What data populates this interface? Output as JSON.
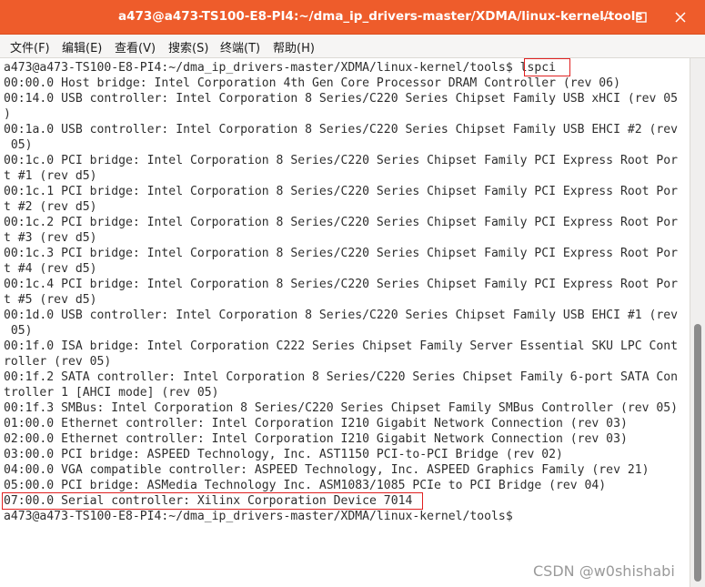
{
  "window": {
    "title": "a473@a473-TS100-E8-PI4:~/dma_ip_drivers-master/XDMA/linux-kernel/tools",
    "accent_color": "#ee5c2b",
    "controls": [
      "minimize-icon",
      "maximize-icon",
      "close-icon"
    ]
  },
  "menu": {
    "items": [
      {
        "label": "文件(F)"
      },
      {
        "label": "编辑(E)"
      },
      {
        "label": "查看(V)"
      },
      {
        "label": "搜索(S)"
      },
      {
        "label": "终端(T)"
      },
      {
        "label": "帮助(H)"
      }
    ]
  },
  "terminal": {
    "prompt": "a473@a473-TS100-E8-PI4:~/dma_ip_drivers-master/XDMA/linux-kernel/tools$",
    "command": "lspci",
    "highlight_color": "#e02020",
    "lines": [
      "00:00.0 Host bridge: Intel Corporation 4th Gen Core Processor DRAM Controller (rev 06)",
      "00:14.0 USB controller: Intel Corporation 8 Series/C220 Series Chipset Family USB xHCI (rev 05",
      ")",
      "00:1a.0 USB controller: Intel Corporation 8 Series/C220 Series Chipset Family USB EHCI #2 (rev",
      " 05)",
      "00:1c.0 PCI bridge: Intel Corporation 8 Series/C220 Series Chipset Family PCI Express Root Por",
      "t #1 (rev d5)",
      "00:1c.1 PCI bridge: Intel Corporation 8 Series/C220 Series Chipset Family PCI Express Root Por",
      "t #2 (rev d5)",
      "00:1c.2 PCI bridge: Intel Corporation 8 Series/C220 Series Chipset Family PCI Express Root Por",
      "t #3 (rev d5)",
      "00:1c.3 PCI bridge: Intel Corporation 8 Series/C220 Series Chipset Family PCI Express Root Por",
      "t #4 (rev d5)",
      "00:1c.4 PCI bridge: Intel Corporation 8 Series/C220 Series Chipset Family PCI Express Root Por",
      "t #5 (rev d5)",
      "00:1d.0 USB controller: Intel Corporation 8 Series/C220 Series Chipset Family USB EHCI #1 (rev",
      " 05)",
      "00:1f.0 ISA bridge: Intel Corporation C222 Series Chipset Family Server Essential SKU LPC Cont",
      "roller (rev 05)",
      "00:1f.2 SATA controller: Intel Corporation 8 Series/C220 Series Chipset Family 6-port SATA Con",
      "troller 1 [AHCI mode] (rev 05)",
      "00:1f.3 SMBus: Intel Corporation 8 Series/C220 Series Chipset Family SMBus Controller (rev 05)",
      "01:00.0 Ethernet controller: Intel Corporation I210 Gigabit Network Connection (rev 03)",
      "02:00.0 Ethernet controller: Intel Corporation I210 Gigabit Network Connection (rev 03)",
      "03:00.0 PCI bridge: ASPEED Technology, Inc. AST1150 PCI-to-PCI Bridge (rev 02)",
      "04:00.0 VGA compatible controller: ASPEED Technology, Inc. ASPEED Graphics Family (rev 21)",
      "05:00.0 PCI bridge: ASMedia Technology Inc. ASM1083/1085 PCIe to PCI Bridge (rev 04)",
      "07:00.0 Serial controller: Xilinx Corporation Device 7014"
    ],
    "final_prompt": "a473@a473-TS100-E8-PI4:~/dma_ip_drivers-master/XDMA/linux-kernel/tools$"
  },
  "watermark": "CSDN @w0shishabi"
}
